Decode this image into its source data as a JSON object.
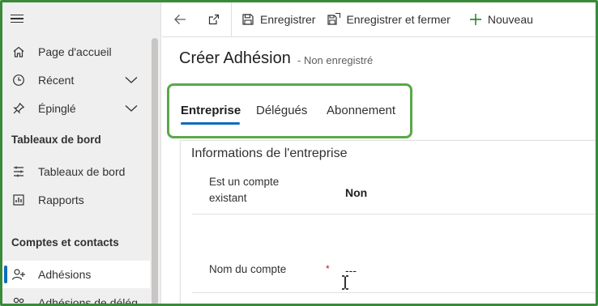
{
  "sidebar": {
    "items_top": [
      {
        "label": "Page d'accueil",
        "icon": "home-icon"
      },
      {
        "label": "Récent",
        "icon": "clock-icon",
        "chevron": true
      },
      {
        "label": "Épinglé",
        "icon": "pin-icon",
        "chevron": true
      }
    ],
    "section_dashboards": "Tableaux de bord",
    "items_dashboards": [
      {
        "label": "Tableaux de bord",
        "icon": "dashboard-icon"
      },
      {
        "label": "Rapports",
        "icon": "report-icon"
      }
    ],
    "section_accounts": "Comptes et contacts",
    "items_accounts": [
      {
        "label": "Adhésions",
        "icon": "add-person-icon",
        "active": true
      },
      {
        "label": "Adhésions de délégués",
        "icon": "people-icon"
      }
    ]
  },
  "toolbar": {
    "save_label": "Enregistrer",
    "save_close_label": "Enregistrer et fermer",
    "new_label": "Nouveau"
  },
  "form": {
    "title": "Créer Adhésion",
    "status": "- Non enregistré"
  },
  "tabs": [
    {
      "label": "Entreprise",
      "active": true
    },
    {
      "label": "Délégués"
    },
    {
      "label": "Abonnement"
    }
  ],
  "section": {
    "title": "Informations de l'entreprise",
    "fields": [
      {
        "label_line1": "Est un compte",
        "label_line2": "existant",
        "value": "Non"
      },
      {
        "label": "Nom du compte",
        "required_mark": "*",
        "value": "---"
      }
    ]
  },
  "colors": {
    "accent": "#0f6cbd",
    "highlight": "#5aa84b",
    "frame": "#3a8a3a",
    "required": "#a4262c",
    "new_icon": "#107c10"
  }
}
